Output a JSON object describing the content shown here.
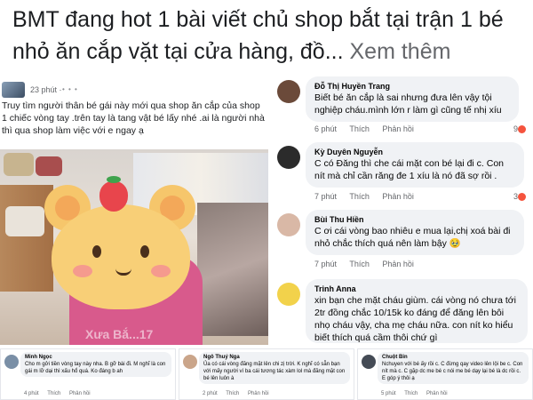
{
  "headline": {
    "text": "BMT đang hot 1 bài viết chủ shop bắt tại trận 1 bé nhỏ ăn cắp vặt tại cửa hàng, đồ...",
    "more_label": "Xem thêm"
  },
  "post": {
    "time": "23 phút ·",
    "dots": "• • •",
    "text": "Truy tìm người thân bé gái này mới qua shop ăn cắp của shop 1 chiếc vòng tay .trên tay là tang vật bé lấy nhé .ai là người nhà thì qua shop làm việc với e ngay ạ",
    "photo_watermark": "Xưa Bắ...17"
  },
  "comments": [
    {
      "name": "Đỗ Thị Huyền Trang",
      "text": "Biết bé ăn cắp là sai nhưng đưa lên vậy tội nghiệp cháu.mình lớn r làm gì cũng tế nhị xíu",
      "time": "6 phút",
      "like": "Thích",
      "reply": "Phản hồi",
      "reactions": "9",
      "avatar_color": "#6b4a3a"
    },
    {
      "name": "Kỳ Duyên Nguyễn",
      "text": "C có Đăng thì che cái mặt con bé lại đi c. Con nít mà chỉ cần răng đe 1 xíu là nó đã sợ rồi .",
      "time": "7 phút",
      "like": "Thích",
      "reply": "Phản hồi",
      "reactions": "3",
      "avatar_color": "#2b2b2b"
    },
    {
      "name": "Bùi Thu Hiền",
      "text": "C ơi cái vòng bao nhiêu e mua lại,chị xoá bài đi nhỏ chắc thích quá nên làm bậy 🥹",
      "time": "7 phút",
      "like": "Thích",
      "reply": "Phản hồi",
      "reactions": "",
      "avatar_color": "#d9b8a6"
    },
    {
      "name": "Trinh Anna",
      "text": "xin  bạn che mặt cháu giùm. cái vòng nó chưa tới 2tr đồng chắc 10/15k ko đáng  để đăng lên bôi nhọ cháu vậy, cha mẹ cháu nữa. con nít ko hiểu biết thích quá cầm thôi chứ gì",
      "time": "",
      "like": "",
      "reply": "",
      "reactions": "",
      "avatar_color": "#f2d24b"
    }
  ],
  "bottom": [
    {
      "name": "Minh Ngọc",
      "text": "Cho m gởi tiền vòng tay này nha. B gỡ bài đi. M nghĩ là con gái m lỡ dại thì xấu hổ quá. Ko đáng b ah",
      "time": "4 phút",
      "like": "Thích",
      "reply": "Phản hồi",
      "avatar_color": "#7a8fa6"
    },
    {
      "name": "Ngô Thuý Nga",
      "text": "Ủa có cái vòng đăng mặt lên chi zị trời. K nghĩ có sẵn bạn với mấy người ví ba cái tương tác xàm lol mà đăng mặt con bé lên luôn à",
      "time": "2 phút",
      "like": "Thích",
      "reply": "Phản hồi",
      "avatar_color": "#caa58a"
    },
    {
      "name": "Chuột Bin",
      "text": "Nchuyen với bé ấy rồi c. C đừng qay video lên lội be c. Con nít mà c. C gặp dc me bé c nói me bé dạy lại bé là dc rồi c. E góp ý thôi ạ",
      "time": "5 phút",
      "like": "Thích",
      "reply": "Phản hồi",
      "avatar_color": "#444b55"
    }
  ]
}
